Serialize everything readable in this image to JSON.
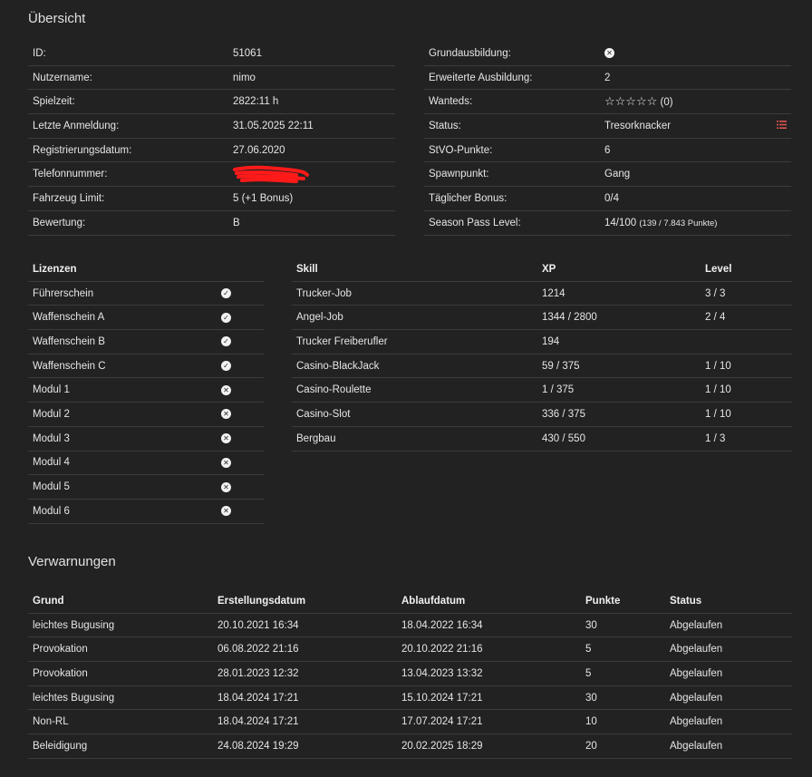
{
  "overview": {
    "title": "Übersicht",
    "left": [
      {
        "label": "ID:",
        "value": "51061"
      },
      {
        "label": "Nutzername:",
        "value": "nimo"
      },
      {
        "label": "Spielzeit:",
        "value": "2822:11 h"
      },
      {
        "label": "Letzte Anmeldung:",
        "value": "31.05.2025 22:11"
      },
      {
        "label": "Registrierungsdatum:",
        "value": "27.06.2020"
      },
      {
        "label": "Telefonnummer:",
        "value": ""
      },
      {
        "label": "Fahrzeug Limit:",
        "value": "5 (+1 Bonus)"
      },
      {
        "label": "Bewertung:",
        "value": "B"
      }
    ],
    "right": [
      {
        "label": "Grundausbildung:",
        "value": ""
      },
      {
        "label": "Erweiterte Ausbildung:",
        "value": "2"
      },
      {
        "label": "Wanteds:",
        "value": "☆☆☆☆☆",
        "extra": "(0)"
      },
      {
        "label": "Status:",
        "value": "Tresorknacker"
      },
      {
        "label": "StVO-Punkte:",
        "value": "6"
      },
      {
        "label": "Spawnpunkt:",
        "value": "Gang"
      },
      {
        "label": "Täglicher Bonus:",
        "value": "0/4"
      },
      {
        "label": "Season Pass Level:",
        "value": "14/100",
        "extra": "(139 / 7.843 Punkte)"
      }
    ]
  },
  "licenses": {
    "header": "Lizenzen",
    "items": [
      {
        "name": "Führerschein",
        "status": "yes"
      },
      {
        "name": "Waffenschein A",
        "status": "yes"
      },
      {
        "name": "Waffenschein B",
        "status": "yes"
      },
      {
        "name": "Waffenschein C",
        "status": "yes"
      },
      {
        "name": "Modul 1",
        "status": "no"
      },
      {
        "name": "Modul 2",
        "status": "no"
      },
      {
        "name": "Modul 3",
        "status": "no"
      },
      {
        "name": "Modul 4",
        "status": "no"
      },
      {
        "name": "Modul 5",
        "status": "no"
      },
      {
        "name": "Modul 6",
        "status": "no"
      }
    ]
  },
  "skills": {
    "headers": [
      "Skill",
      "XP",
      "Level"
    ],
    "rows": [
      [
        "Trucker-Job",
        "1214",
        "3 / 3"
      ],
      [
        "Angel-Job",
        "1344 / 2800",
        "2 / 4"
      ],
      [
        "Trucker Freiberufler",
        "194",
        ""
      ],
      [
        "Casino-BlackJack",
        "59 / 375",
        "1 / 10"
      ],
      [
        "Casino-Roulette",
        "1 / 375",
        "1 / 10"
      ],
      [
        "Casino-Slot",
        "336 / 375",
        "1 / 10"
      ],
      [
        "Bergbau",
        "430 / 550",
        "1 / 3"
      ]
    ]
  },
  "warnings": {
    "title": "Verwarnungen",
    "headers": [
      "Grund",
      "Erstellungsdatum",
      "Ablaufdatum",
      "Punkte",
      "Status"
    ],
    "rows": [
      [
        "leichtes Bugusing",
        "20.10.2021 16:34",
        "18.04.2022 16:34",
        "30",
        "Abgelaufen"
      ],
      [
        "Provokation",
        "06.08.2022 21:16",
        "20.10.2022 21:16",
        "5",
        "Abgelaufen"
      ],
      [
        "Provokation",
        "28.01.2023 12:32",
        "13.04.2023 13:32",
        "5",
        "Abgelaufen"
      ],
      [
        "leichtes Bugusing",
        "18.04.2024 17:21",
        "15.10.2024 17:21",
        "30",
        "Abgelaufen"
      ],
      [
        "Non-RL",
        "18.04.2024 17:21",
        "17.07.2024 17:21",
        "10",
        "Abgelaufen"
      ],
      [
        "Beleidigung",
        "24.08.2024 19:29",
        "20.02.2025 18:29",
        "20",
        "Abgelaufen"
      ]
    ]
  },
  "icons": {
    "check": "check-circle-icon",
    "cross": "x-circle-icon",
    "list": "list-icon"
  },
  "colors": {
    "background": "#222222",
    "accent_red": "#d9534f",
    "redaction": "#ff1a1a"
  }
}
